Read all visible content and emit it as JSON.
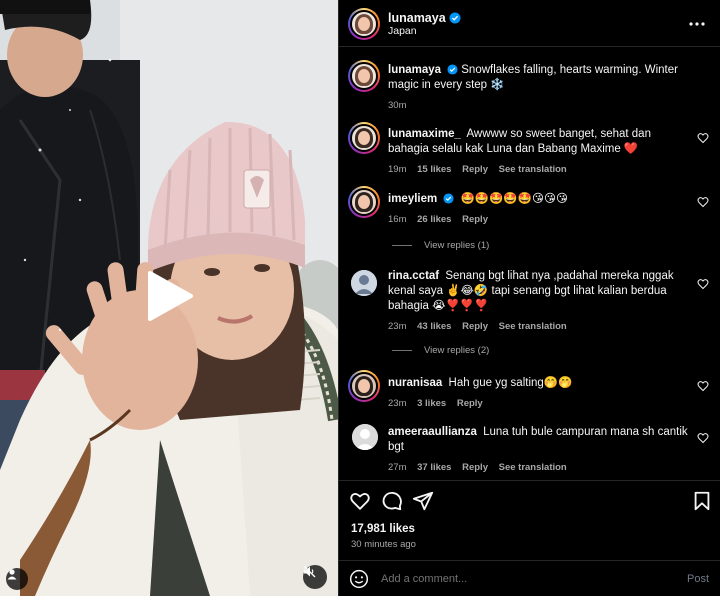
{
  "post": {
    "username": "lunamaya",
    "location": "Japan",
    "verified": true
  },
  "caption": {
    "username": "lunamaya",
    "text": "Snowflakes falling, hearts warming. Winter magic in every step ❄️",
    "time": "30m"
  },
  "comments": [
    {
      "username": "lunamaxime_",
      "text": "Awwww so sweet banget, sehat dan bahagia selalu kak Luna dan Babang Maxime ❤️",
      "time": "19m",
      "likes": "15 likes",
      "reply": "Reply",
      "translate": "See translation"
    },
    {
      "username": "imeyliem",
      "verified": true,
      "text": "🤩🤩🤩🤩🤩😘😘😘",
      "time": "16m",
      "likes": "26 likes",
      "reply": "Reply",
      "view_replies": "View replies (1)"
    },
    {
      "username": "rina.cctaf",
      "text": "Senang bgt lihat nya ,padahal mereka nggak kenal saya ✌️😂🤣 tapi senang bgt lihat kalian berdua bahagia 😭❣️❣️❣️",
      "time": "23m",
      "likes": "43 likes",
      "reply": "Reply",
      "translate": "See translation",
      "view_replies": "View replies (2)"
    },
    {
      "username": "nuranisaa",
      "text": "Hah gue yg salting🤭🤭",
      "time": "23m",
      "likes": "3 likes",
      "reply": "Reply"
    },
    {
      "username": "ameeraaullianza",
      "text": "Luna tuh bule campuran mana sh cantik bgt",
      "time": "27m",
      "likes": "37 likes",
      "reply": "Reply",
      "translate": "See translation"
    }
  ],
  "stats": {
    "likes": "17,981 likes",
    "time_ago": "30 minutes ago"
  },
  "composer": {
    "placeholder": "Add a comment...",
    "post_label": "Post"
  },
  "icons": {
    "more": "more-horizontal-icon",
    "like": "heart-icon",
    "comment": "comment-icon",
    "share": "share-icon",
    "save": "bookmark-icon",
    "emoji": "emoji-icon",
    "play": "play-icon",
    "mute": "mute-icon",
    "user": "user-icon"
  },
  "colors": {
    "verified": "#0095f6",
    "heart": "#ed4956"
  }
}
